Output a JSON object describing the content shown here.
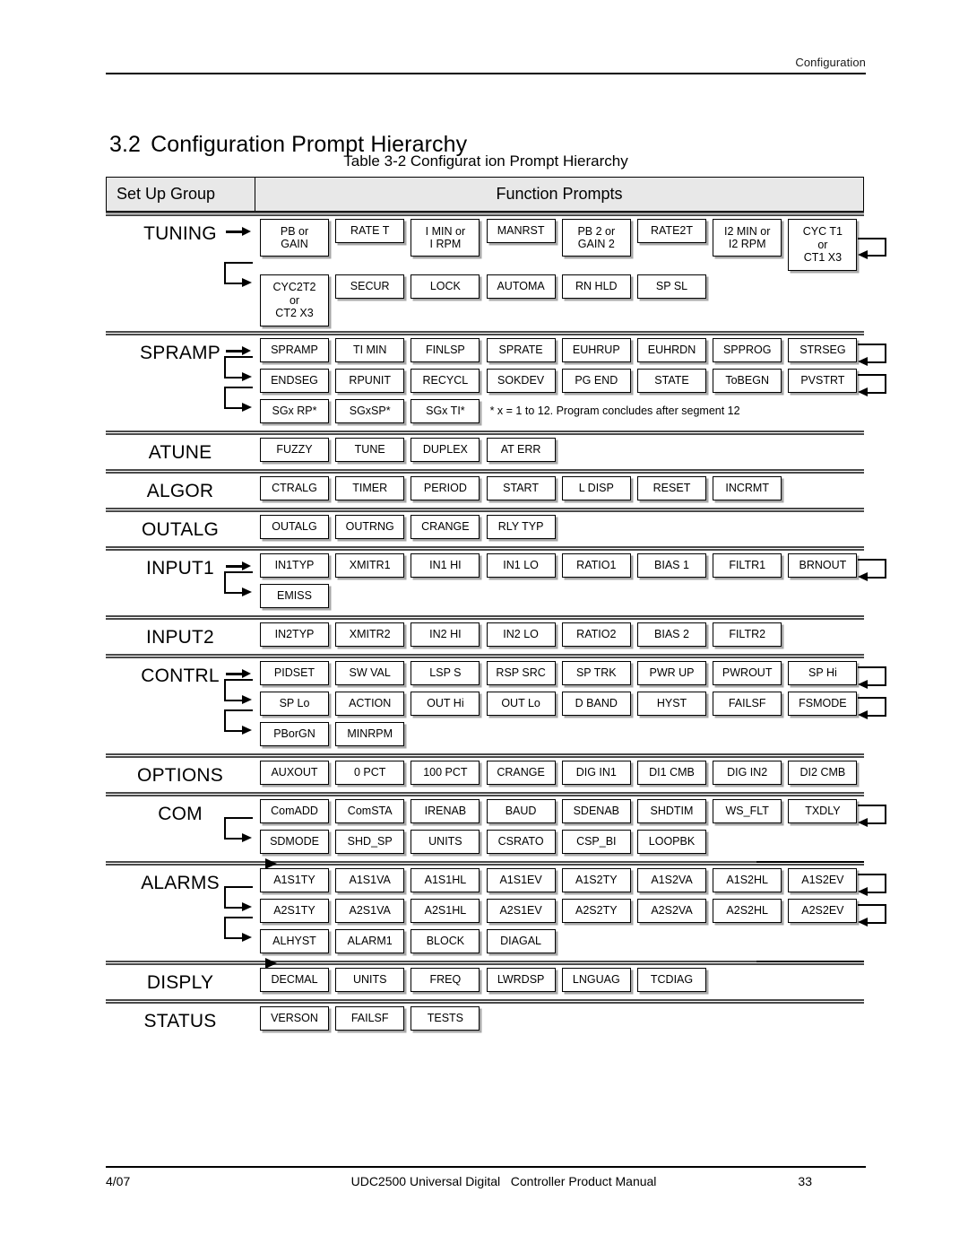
{
  "page": {
    "running_header": "Configuration",
    "section_number": "3.2",
    "section_title": "Configuration Prompt Hierarchy",
    "table_caption": "Table 3-2  Configurat  ion Prompt Hierarchy"
  },
  "table": {
    "header": {
      "col_group": "Set Up Group",
      "col_prompts": "Function Prompts"
    },
    "groups": [
      {
        "name": "TUNING",
        "rows": [
          {
            "entry_arrow": true,
            "wrap_out": true,
            "boxes": [
              {
                "lines": [
                  "PB or",
                  "GAIN"
                ]
              },
              {
                "lines": [
                  "RATE T"
                ]
              },
              {
                "lines": [
                  "I MIN or",
                  "I RPM"
                ]
              },
              {
                "lines": [
                  "MANRST"
                ]
              },
              {
                "lines": [
                  "PB 2 or",
                  "GAIN 2"
                ]
              },
              {
                "lines": [
                  "RATE2T"
                ]
              },
              {
                "lines": [
                  "I2 MIN or",
                  "I2 RPM"
                ]
              },
              {
                "lines": [
                  "CYC T1",
                  "or",
                  "CT1 X3"
                ]
              }
            ]
          },
          {
            "wrap_in": true,
            "boxes": [
              {
                "lines": [
                  "CYC2T2",
                  "or",
                  "CT2 X3"
                ]
              },
              {
                "lines": [
                  "SECUR"
                ]
              },
              {
                "lines": [
                  "LOCK"
                ]
              },
              {
                "lines": [
                  "AUTOMA"
                ]
              },
              {
                "lines": [
                  "RN HLD"
                ]
              },
              {
                "lines": [
                  "SP SL"
                ]
              }
            ]
          }
        ]
      },
      {
        "name": "SPRAMP",
        "rows": [
          {
            "entry_arrow": true,
            "wrap_out": true,
            "boxes": [
              {
                "lines": [
                  "SPRAMP"
                ]
              },
              {
                "lines": [
                  "TI MIN"
                ]
              },
              {
                "lines": [
                  "FINLSP"
                ]
              },
              {
                "lines": [
                  "SPRATE"
                ]
              },
              {
                "lines": [
                  "EUHRUP"
                ]
              },
              {
                "lines": [
                  "EUHRDN"
                ]
              },
              {
                "lines": [
                  "SPPROG"
                ]
              },
              {
                "lines": [
                  "STRSEG"
                ]
              }
            ]
          },
          {
            "wrap_in": true,
            "wrap_out": true,
            "boxes": [
              {
                "lines": [
                  "ENDSEG"
                ]
              },
              {
                "lines": [
                  "RPUNIT"
                ]
              },
              {
                "lines": [
                  "RECYCL"
                ]
              },
              {
                "lines": [
                  "SOKDEV"
                ]
              },
              {
                "lines": [
                  "PG END"
                ]
              },
              {
                "lines": [
                  "STATE"
                ]
              },
              {
                "lines": [
                  "ToBEGN"
                ]
              },
              {
                "lines": [
                  "PVSTRT"
                ]
              }
            ]
          },
          {
            "wrap_in": true,
            "boxes": [
              {
                "lines": [
                  "SGx RP*"
                ]
              },
              {
                "lines": [
                  "SGxSP*"
                ]
              },
              {
                "lines": [
                  "SGx TI*"
                ]
              }
            ],
            "note": "* x = 1 to 12. Program concludes after segment 12"
          }
        ]
      },
      {
        "name": "ATUNE",
        "rows": [
          {
            "boxes": [
              {
                "lines": [
                  "FUZZY"
                ]
              },
              {
                "lines": [
                  "TUNE"
                ]
              },
              {
                "lines": [
                  "DUPLEX"
                ]
              },
              {
                "lines": [
                  "AT ERR"
                ]
              }
            ]
          }
        ]
      },
      {
        "name": "ALGOR",
        "rows": [
          {
            "boxes": [
              {
                "lines": [
                  "CTRALG"
                ]
              },
              {
                "lines": [
                  "TIMER"
                ]
              },
              {
                "lines": [
                  "PERIOD"
                ]
              },
              {
                "lines": [
                  "START"
                ]
              },
              {
                "lines": [
                  "L DISP"
                ]
              },
              {
                "lines": [
                  "RESET"
                ]
              },
              {
                "lines": [
                  "INCRMT"
                ]
              }
            ]
          }
        ]
      },
      {
        "name": "OUTALG",
        "rows": [
          {
            "boxes": [
              {
                "lines": [
                  "OUTALG"
                ]
              },
              {
                "lines": [
                  "OUTRNG"
                ]
              },
              {
                "lines": [
                  "CRANGE"
                ]
              },
              {
                "lines": [
                  "RLY TYP"
                ]
              }
            ]
          }
        ]
      },
      {
        "name": "INPUT1",
        "rows": [
          {
            "entry_arrow": true,
            "wrap_out": true,
            "boxes": [
              {
                "lines": [
                  "IN1TYP"
                ]
              },
              {
                "lines": [
                  "XMITR1"
                ]
              },
              {
                "lines": [
                  "IN1 HI"
                ]
              },
              {
                "lines": [
                  "IN1 LO"
                ]
              },
              {
                "lines": [
                  "RATIO1"
                ]
              },
              {
                "lines": [
                  "BIAS 1"
                ]
              },
              {
                "lines": [
                  "FILTR1"
                ]
              },
              {
                "lines": [
                  "BRNOUT"
                ]
              }
            ]
          },
          {
            "wrap_in": true,
            "boxes": [
              {
                "lines": [
                  "EMISS"
                ]
              }
            ]
          }
        ]
      },
      {
        "name": "INPUT2",
        "rows": [
          {
            "boxes": [
              {
                "lines": [
                  "IN2TYP"
                ]
              },
              {
                "lines": [
                  "XMITR2"
                ]
              },
              {
                "lines": [
                  "IN2 HI"
                ]
              },
              {
                "lines": [
                  "IN2 LO"
                ]
              },
              {
                "lines": [
                  "RATIO2"
                ]
              },
              {
                "lines": [
                  "BIAS 2"
                ]
              },
              {
                "lines": [
                  "FILTR2"
                ]
              }
            ]
          }
        ]
      },
      {
        "name": "CONTRL",
        "rows": [
          {
            "entry_arrow": true,
            "wrap_out": true,
            "boxes": [
              {
                "lines": [
                  "PIDSET"
                ]
              },
              {
                "lines": [
                  "SW VAL"
                ]
              },
              {
                "lines": [
                  "LSP S"
                ]
              },
              {
                "lines": [
                  "RSP SRC"
                ]
              },
              {
                "lines": [
                  "SP TRK"
                ]
              },
              {
                "lines": [
                  "PWR UP"
                ]
              },
              {
                "lines": [
                  "PWROUT"
                ]
              },
              {
                "lines": [
                  "SP Hi"
                ]
              }
            ]
          },
          {
            "wrap_in": true,
            "wrap_out": true,
            "boxes": [
              {
                "lines": [
                  "SP Lo"
                ]
              },
              {
                "lines": [
                  "ACTION"
                ]
              },
              {
                "lines": [
                  "OUT Hi"
                ]
              },
              {
                "lines": [
                  "OUT Lo"
                ]
              },
              {
                "lines": [
                  "D BAND"
                ]
              },
              {
                "lines": [
                  "HYST"
                ]
              },
              {
                "lines": [
                  "FAILSF"
                ]
              },
              {
                "lines": [
                  "FSMODE"
                ]
              }
            ]
          },
          {
            "wrap_in": true,
            "boxes": [
              {
                "lines": [
                  "PBorGN"
                ]
              },
              {
                "lines": [
                  "MINRPM"
                ]
              }
            ]
          }
        ]
      },
      {
        "name": "OPTIONS",
        "rows": [
          {
            "boxes": [
              {
                "lines": [
                  "AUXOUT"
                ]
              },
              {
                "lines": [
                  "0 PCT"
                ]
              },
              {
                "lines": [
                  "100 PCT"
                ]
              },
              {
                "lines": [
                  "CRANGE"
                ]
              },
              {
                "lines": [
                  "DIG IN1"
                ]
              },
              {
                "lines": [
                  "DI1 CMB"
                ]
              },
              {
                "lines": [
                  "DIG IN2"
                ]
              },
              {
                "lines": [
                  "DI2 CMB"
                ]
              }
            ]
          }
        ]
      },
      {
        "name": "COM",
        "rows": [
          {
            "wrap_out": true,
            "boxes": [
              {
                "lines": [
                  "ComADD"
                ]
              },
              {
                "lines": [
                  "ComSTA"
                ]
              },
              {
                "lines": [
                  "IRENAB"
                ]
              },
              {
                "lines": [
                  "BAUD"
                ]
              },
              {
                "lines": [
                  "SDENAB"
                ]
              },
              {
                "lines": [
                  "SHDTIM"
                ]
              },
              {
                "lines": [
                  "WS_FLT"
                ]
              },
              {
                "lines": [
                  "TXDLY"
                ]
              }
            ]
          },
          {
            "wrap_in": true,
            "boxes": [
              {
                "lines": [
                  "SDMODE"
                ]
              },
              {
                "lines": [
                  "SHD_SP"
                ]
              },
              {
                "lines": [
                  "UNITS"
                ]
              },
              {
                "lines": [
                  "CSRATO"
                ]
              },
              {
                "lines": [
                  "CSP_BI"
                ]
              },
              {
                "lines": [
                  "LOOPBK"
                ]
              }
            ]
          }
        ]
      },
      {
        "name": "ALARMS",
        "rows": [
          {
            "wrap_out": true,
            "boxes": [
              {
                "lines": [
                  "A1S1TY"
                ]
              },
              {
                "lines": [
                  "A1S1VA"
                ]
              },
              {
                "lines": [
                  "A1S1HL"
                ]
              },
              {
                "lines": [
                  "A1S1EV"
                ]
              },
              {
                "lines": [
                  "A1S2TY"
                ]
              },
              {
                "lines": [
                  "A1S2VA"
                ]
              },
              {
                "lines": [
                  "A1S2HL"
                ]
              },
              {
                "lines": [
                  "A1S2EV"
                ]
              }
            ]
          },
          {
            "wrap_in": true,
            "wrap_out": true,
            "boxes": [
              {
                "lines": [
                  "A2S1TY"
                ]
              },
              {
                "lines": [
                  "A2S1VA"
                ]
              },
              {
                "lines": [
                  "A2S1HL"
                ]
              },
              {
                "lines": [
                  "A2S1EV"
                ]
              },
              {
                "lines": [
                  "A2S2TY"
                ]
              },
              {
                "lines": [
                  "A2S2VA"
                ]
              },
              {
                "lines": [
                  "A2S2HL"
                ]
              },
              {
                "lines": [
                  "A2S2EV"
                ]
              }
            ]
          },
          {
            "wrap_in": true,
            "boxes": [
              {
                "lines": [
                  "ALHYST"
                ]
              },
              {
                "lines": [
                  "ALARM1"
                ]
              },
              {
                "lines": [
                  "BLOCK"
                ]
              },
              {
                "lines": [
                  "DIAGAL"
                ]
              }
            ]
          }
        ]
      },
      {
        "name": "DISPLY",
        "rows": [
          {
            "boxes": [
              {
                "lines": [
                  "DECMAL"
                ]
              },
              {
                "lines": [
                  "UNITS"
                ]
              },
              {
                "lines": [
                  "FREQ"
                ]
              },
              {
                "lines": [
                  "LWRDSP"
                ]
              },
              {
                "lines": [
                  "LNGUAG"
                ]
              },
              {
                "lines": [
                  "TCDIAG"
                ]
              }
            ]
          }
        ]
      },
      {
        "name": "STATUS",
        "rows": [
          {
            "boxes": [
              {
                "lines": [
                  "VERSON"
                ]
              },
              {
                "lines": [
                  "FAILSF"
                ]
              },
              {
                "lines": [
                  "TESTS"
                ]
              }
            ]
          }
        ]
      }
    ]
  },
  "footer": {
    "date": "4/07",
    "title": "UDC2500 Universal Digital   Controller Product Manual",
    "page_number": "33"
  }
}
